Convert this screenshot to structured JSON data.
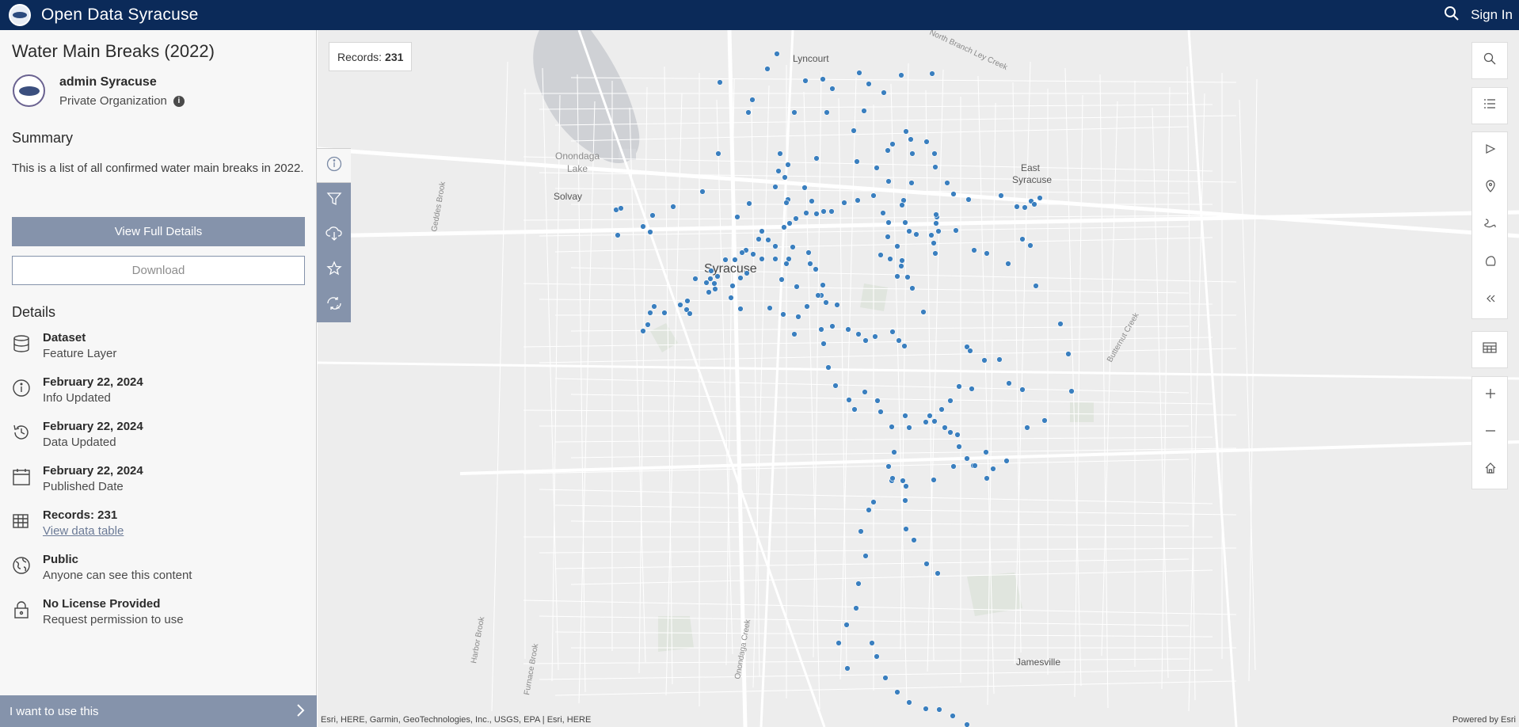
{
  "header": {
    "site_title": "Open Data Syracuse",
    "sign_in": "Sign In"
  },
  "item": {
    "title": "Water Main Breaks (2022)",
    "owner_name": "admin Syracuse",
    "owner_org": "Private Organization"
  },
  "summary": {
    "heading": "Summary",
    "text": "This is a list of all confirmed water main breaks in 2022."
  },
  "buttons": {
    "view_full_details": "View Full Details",
    "download": "Download"
  },
  "details": {
    "heading": "Details",
    "items": [
      {
        "icon": "database-icon",
        "title": "Dataset",
        "subtitle": "Feature Layer"
      },
      {
        "icon": "info-icon",
        "title": "February 22, 2024",
        "subtitle": "Info Updated"
      },
      {
        "icon": "history-icon",
        "title": "February 22, 2024",
        "subtitle": "Data Updated"
      },
      {
        "icon": "calendar-icon",
        "title": "February 22, 2024",
        "subtitle": "Published Date"
      },
      {
        "icon": "table-icon",
        "title": "Records: 231",
        "subtitle": "View data table"
      },
      {
        "icon": "globe-icon",
        "title": "Public",
        "subtitle": "Anyone can see this content"
      },
      {
        "icon": "lock-icon",
        "title": "No License Provided",
        "subtitle": "Request permission to use"
      }
    ]
  },
  "cta": {
    "label": "I want to use this"
  },
  "map": {
    "records_label": "Records:",
    "records_count": "231",
    "attribution": "Esri, HERE, Garmin, GeoTechnologies, Inc., USGS, EPA | Esri, HERE",
    "powered_by": "Powered by Esri",
    "place_labels": [
      "Lyncourt",
      "Onondaga",
      "Lake",
      "East",
      "Syracuse",
      "Solvay",
      "Syracuse",
      "Jamesville",
      "Geddes Brook",
      "Harbor Brook",
      "Furnace Brook",
      "Onondaga Creek",
      "Butternut Creek",
      "North Branch Ley Creek"
    ],
    "point_color": "#3a7fbf"
  }
}
